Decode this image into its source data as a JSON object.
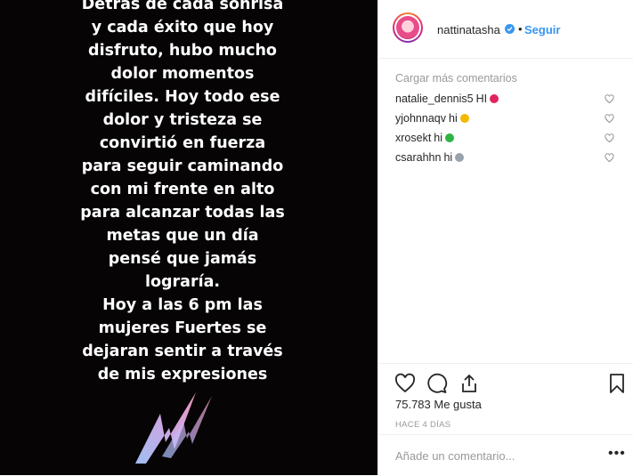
{
  "post": {
    "quote_lines": [
      "Detrás de cada sonrisa",
      "y cada éxito que hoy",
      "disfruto, hubo mucho",
      "dolor momentos",
      "difíciles. Hoy todo ese",
      "dolor y tristeza se",
      "convirtió en fuerza",
      "para seguir caminando",
      "con mi frente en alto",
      "para alcanzar todas las",
      "metas que un día",
      "pensé que jamás",
      "lograría.",
      "Hoy a las 6 pm las",
      "mujeres Fuertes se",
      "dejaran sentir a través",
      "de mis expresiones"
    ]
  },
  "header": {
    "username": "nattinatasha",
    "separator": "•",
    "follow_label": "Seguir"
  },
  "comments": {
    "load_more": "Cargar más comentarios",
    "items": [
      {
        "user": "natalie_dennis5",
        "text": "HI",
        "emoji": "heart-eyes-icon",
        "emoji_color": "#e0245e"
      },
      {
        "user": "yjohnnaqv",
        "text": "hi",
        "emoji": "kissing-face-icon",
        "emoji_color": "#f5b700"
      },
      {
        "user": "xrosekt",
        "text": "hi",
        "emoji": "green-heart-icon",
        "emoji_color": "#2fb344"
      },
      {
        "user": "csarahhn",
        "text": "hi",
        "emoji": "cat-face-icon",
        "emoji_color": "#9aa3ad"
      }
    ]
  },
  "actions": {
    "likes": "75.783 Me gusta",
    "time": "HACE 4 DÍAS"
  },
  "add_comment": {
    "placeholder": "Añade un comentario...",
    "more": "•••"
  },
  "colors": {
    "accent": "#3897f0",
    "muted": "#999999",
    "post_bg": "#060404"
  }
}
